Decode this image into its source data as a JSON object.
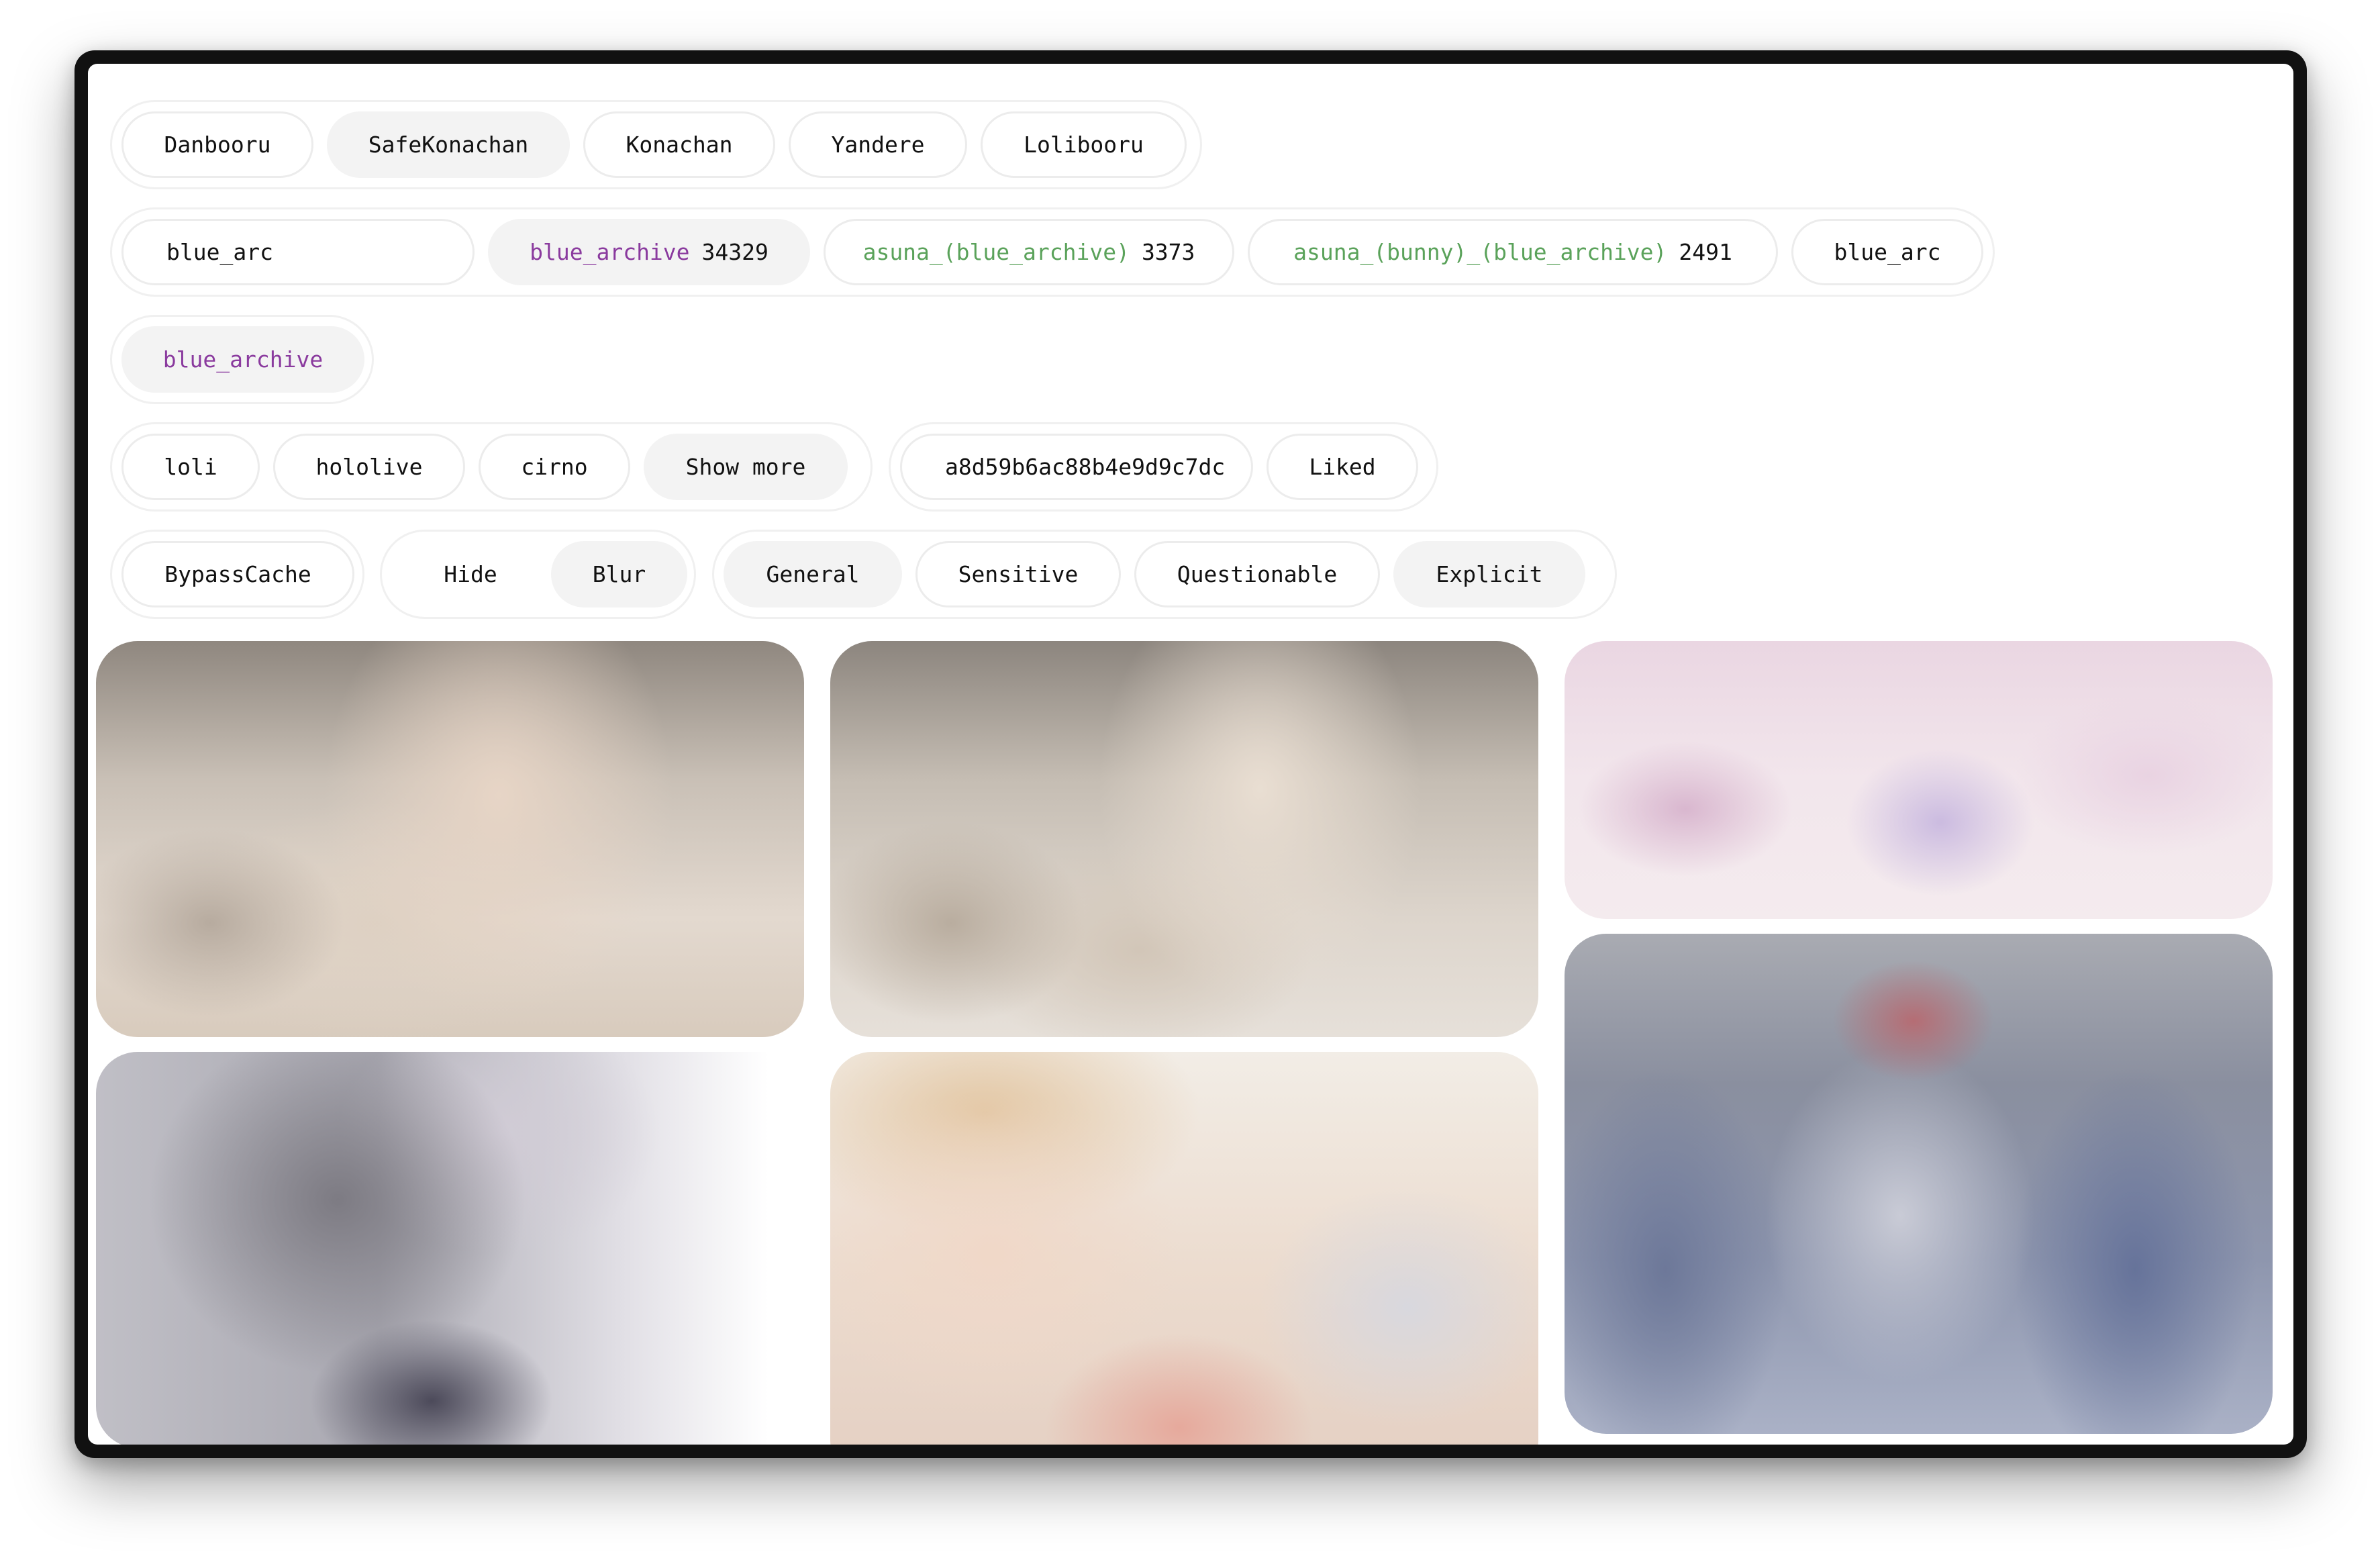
{
  "colors": {
    "copyright_tag": "#8a3a9e",
    "character_tag": "#5aa25a",
    "active_bg": "#f3f3f3",
    "frame": "#111111"
  },
  "sources": {
    "items": [
      "Danbooru",
      "SafeKonachan",
      "Konachan",
      "Yandere",
      "Lolibooru"
    ],
    "selected": "SafeKonachan"
  },
  "search": {
    "value": "blue_arc",
    "suggestions": [
      {
        "name": "blue_archive",
        "count": "34329",
        "kind": "copyright"
      },
      {
        "name": "asuna_(blue_archive)",
        "count": "3373",
        "kind": "character"
      },
      {
        "name": "asuna_(bunny)_(blue_archive)",
        "count": "2491",
        "kind": "character"
      }
    ],
    "submit_label": "blue_arc"
  },
  "selected_tags": [
    "blue_archive"
  ],
  "quick_tags": [
    "loli",
    "hololive",
    "cirno"
  ],
  "show_more_label": "Show more",
  "hash_field": {
    "value": "a8d59b6ac88b4e9d9c7dc"
  },
  "liked_label": "Liked",
  "bypass_cache_label": "BypassCache",
  "display_mode": {
    "options": [
      "Hide",
      "Blur"
    ],
    "selected": "Blur"
  },
  "ratings": {
    "options": [
      "General",
      "Sensitive",
      "Questionable",
      "Explicit"
    ],
    "selected": [
      "General",
      "Explicit"
    ]
  },
  "gallery": {
    "mode": "blurred",
    "tile_count": 7
  }
}
